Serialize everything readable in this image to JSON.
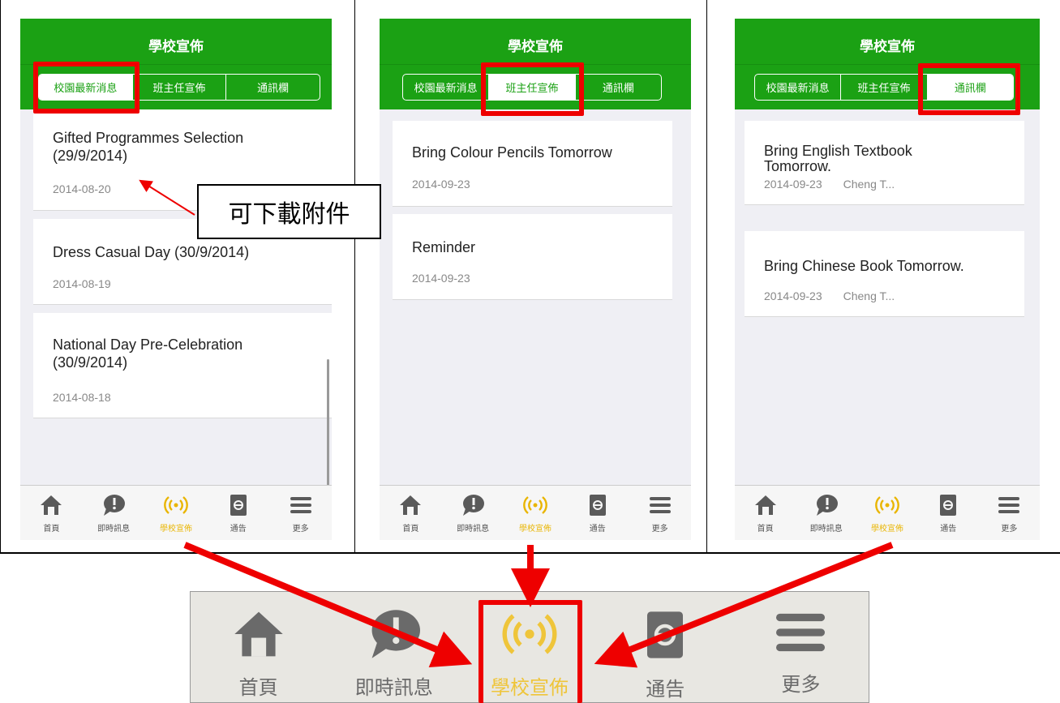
{
  "screens": [
    {
      "header_title": "學校宣佈",
      "segments": [
        "校園最新消息",
        "班主任宣佈",
        "通訊欄"
      ],
      "active_segment": 0,
      "items": [
        {
          "title": "Gifted Programmes Selection (29/9/2014)",
          "date": "2014-08-20",
          "author": ""
        },
        {
          "title": "Dress Casual Day (30/9/2014)",
          "date": "2014-08-19",
          "author": ""
        },
        {
          "title": "National Day Pre-Celebration (30/9/2014)",
          "date": "2014-08-18",
          "author": ""
        }
      ]
    },
    {
      "header_title": "學校宣佈",
      "segments": [
        "校園最新消息",
        "班主任宣佈",
        "通訊欄"
      ],
      "active_segment": 1,
      "items": [
        {
          "title": "Bring Colour Pencils Tomorrow",
          "date": "2014-09-23",
          "author": ""
        },
        {
          "title": "Reminder",
          "date": "2014-09-23",
          "author": ""
        }
      ]
    },
    {
      "header_title": "學校宣佈",
      "segments": [
        "校園最新消息",
        "班主任宣佈",
        "通訊欄"
      ],
      "active_segment": 2,
      "items": [
        {
          "title": "Bring English Textbook Tomorrow.",
          "date": "2014-09-23",
          "author": "Cheng T..."
        },
        {
          "title": "Bring Chinese Book Tomorrow.",
          "date": "2014-09-23",
          "author": "Cheng T..."
        }
      ]
    }
  ],
  "tabbar": [
    {
      "label": "首頁",
      "icon": "home-icon"
    },
    {
      "label": "即時訊息",
      "icon": "chat-alert-icon"
    },
    {
      "label": "學校宣佈",
      "icon": "broadcast-icon"
    },
    {
      "label": "通告",
      "icon": "notice-book-icon"
    },
    {
      "label": "更多",
      "icon": "menu-icon"
    }
  ],
  "active_tab": 2,
  "callout": "可下載附件",
  "colors": {
    "header_green": "#1ba114",
    "active_tab_yellow": "#e9b500",
    "highlight_red": "#e00000"
  }
}
